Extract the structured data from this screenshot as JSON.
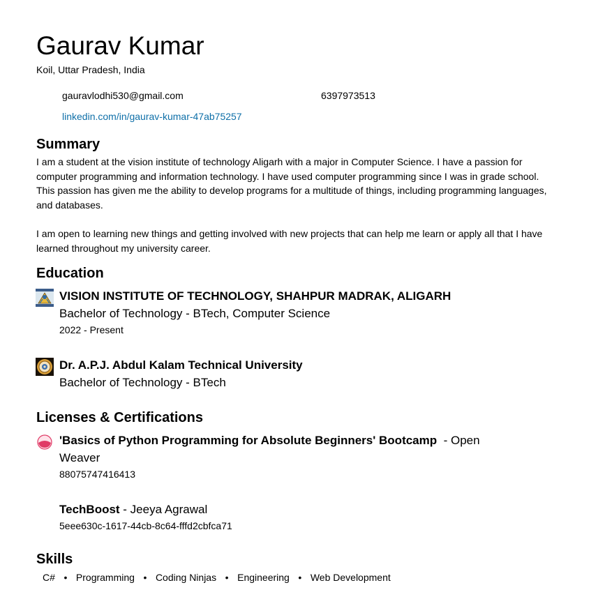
{
  "profile": {
    "name": "Gaurav Kumar",
    "location": "Koil, Uttar Pradesh, India",
    "email": "gauravlodhi530@gmail.com",
    "phone": "6397973513",
    "linkedin": "linkedin.com/in/gaurav-kumar-47ab75257"
  },
  "summary": {
    "heading": "Summary",
    "paragraphs": [
      "I am a student at the vision institute of technology Aligarh with a major in Computer Science. I have a passion for computer programming and information technology. I have used computer programming since I was in grade school. This passion has given me the ability to develop programs for a multitude of things, including programming languages, and databases.",
      "I am open to learning new things and getting involved with new projects that can help me learn or apply all that I have learned throughout my university career."
    ]
  },
  "education": {
    "heading": "Education",
    "entries": [
      {
        "school": "VISION INSTITUTE OF TECHNOLOGY, SHAHPUR MADRAK, ALIGARH",
        "degree": "Bachelor of Technology - BTech, Computer Science",
        "dates": "2022 - Present",
        "logo_icon": "vision-institute-logo"
      },
      {
        "school": "Dr. A.P.J. Abdul Kalam Technical University",
        "degree": "Bachelor of Technology - BTech",
        "dates": "",
        "logo_icon": "aktu-logo"
      }
    ]
  },
  "certifications": {
    "heading": "Licenses & Certifications",
    "entries": [
      {
        "title": "'Basics of Python Programming for Absolute Beginners' Bootcamp",
        "issuer_line1": " - Open",
        "issuer_line2": "Weaver",
        "credential_id": "88075747416413",
        "logo_icon": "open-weaver-logo"
      },
      {
        "title": "TechBoost",
        "issuer": " - Jeeya Agrawal",
        "credential_id": "5eee630c-1617-44cb-8c64-fffd2cbfca71"
      }
    ]
  },
  "skills": {
    "heading": "Skills",
    "separator": "•",
    "items": [
      "C#",
      "Programming",
      "Coding Ninjas",
      "Engineering",
      "Web Development"
    ]
  }
}
